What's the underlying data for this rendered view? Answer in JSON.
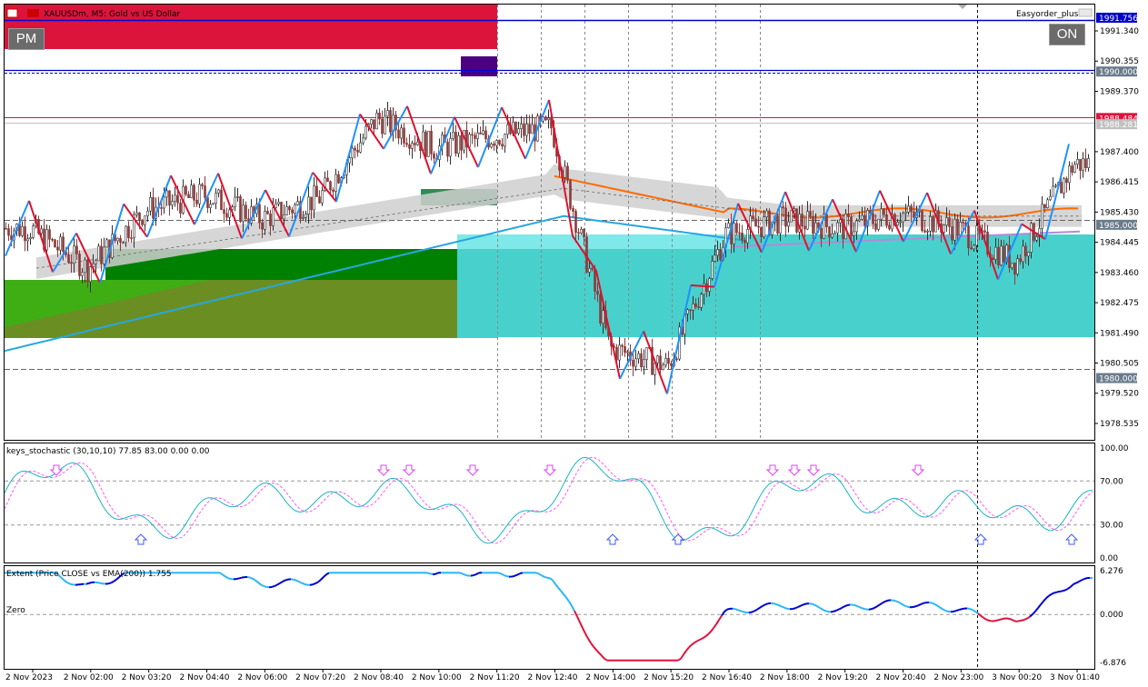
{
  "header": {
    "symbol_title": "XAUUSDm, M5:  Gold vs US Dollar",
    "ea_name": "Easyorder_plus"
  },
  "buttons": {
    "pm": "PM",
    "on": "ON"
  },
  "colors": {
    "bull_candle": "#2f2f2f",
    "bear_candle": "#8b3a3a",
    "zigzag_up": "#1e90ff",
    "zigzag_down": "#e0102c",
    "ema": "#27a7e0",
    "orange_line": "#ff6a00",
    "zone_red": "#dc143c",
    "zone_cyan": "#48d1cc",
    "zone_green": "#008000",
    "zone_olive": "#6b8e23",
    "zone_lime": "#3cb310",
    "stoch_main": "#1ab3c4",
    "stoch_signal": "#ff55ff",
    "extent_up": "#0000cd",
    "extent_up2": "#29b6f6",
    "extent_down": "#e0103c"
  },
  "price_axis": {
    "labels": [
      "1991.340",
      "1990.355",
      "1989.370",
      "1987.400",
      "1986.415",
      "1985.430",
      "1984.445",
      "1983.460",
      "1982.475",
      "1981.490",
      "1980.505",
      "1979.520",
      "1978.535"
    ],
    "tags": [
      {
        "text": "1991.756",
        "bg": "#0000cd",
        "fg": "#ffffff"
      },
      {
        "text": "1990.000",
        "bg": "#6a7b8c",
        "fg": "#ffffff"
      },
      {
        "text": "1988.484",
        "bg": "#dc143c",
        "fg": "#ffffff"
      },
      {
        "text": "1988.281",
        "bg": "#c0c0c0",
        "fg": "#ffffff"
      },
      {
        "text": "1985.000",
        "bg": "#6a7b8c",
        "fg": "#ffffff"
      },
      {
        "text": "1980.000",
        "bg": "#6a7b8c",
        "fg": "#ffffff"
      }
    ]
  },
  "stochastic": {
    "title": "keys_stochastic (30,10,10) 77.85 83.00 0.00 0.00",
    "levels": [
      "100.00",
      "70.00",
      "30.00",
      "0.00"
    ]
  },
  "extent": {
    "title": "Extent (Price CLOSE vs EMA(200)) 1.755",
    "zero_label": "Zero",
    "levels": [
      "6.276",
      "0.000",
      "-6.876"
    ]
  },
  "time_axis": {
    "labels": [
      "2 Nov 2023",
      "2 Nov 02:00",
      "2 Nov 03:20",
      "2 Nov 04:40",
      "2 Nov 06:00",
      "2 Nov 07:20",
      "2 Nov 08:40",
      "2 Nov 10:00",
      "2 Nov 11:20",
      "2 Nov 12:40",
      "2 Nov 14:00",
      "2 Nov 15:20",
      "2 Nov 16:40",
      "2 Nov 18:00",
      "2 Nov 19:20",
      "2 Nov 20:40",
      "2 Nov 23:00",
      "3 Nov 00:20",
      "3 Nov 01:40"
    ]
  },
  "chart_data": {
    "type": "candlestick",
    "symbol": "XAUUSDm",
    "timeframe": "M5",
    "ylim": [
      1978.0,
      1992.2
    ],
    "close_path": [
      [
        "2 Nov 2023",
        1984.9
      ],
      [
        "2 Nov 02:00",
        1983.6
      ],
      [
        "2 Nov 03:20",
        1985.5
      ],
      [
        "2 Nov 04:40",
        1986.0
      ],
      [
        "2 Nov 06:00",
        1985.2
      ],
      [
        "2 Nov 07:20",
        1985.9
      ],
      [
        "2 Nov 08:40",
        1988.5
      ],
      [
        "2 Nov 10:00",
        1987.5
      ],
      [
        "2 Nov 11:20",
        1987.9
      ],
      [
        "2 Nov 12:40",
        1988.2
      ],
      [
        "2 Nov 14:00",
        1981.0
      ],
      [
        "2 Nov 15:20",
        1980.4
      ],
      [
        "2 Nov 16:40",
        1984.7
      ],
      [
        "2 Nov 18:00",
        1985.2
      ],
      [
        "2 Nov 19:20",
        1984.9
      ],
      [
        "2 Nov 20:40",
        1985.4
      ],
      [
        "2 Nov 23:00",
        1984.9
      ],
      [
        "3 Nov 00:20",
        1983.8
      ],
      [
        "3 Nov 01:40",
        1987.0
      ]
    ],
    "horizontal_levels": [
      1991.756,
      1990.0,
      1988.484,
      1988.281,
      1985.0,
      1980.0
    ],
    "stochastic_levels": [
      100,
      70,
      30,
      0
    ],
    "extent_range": [
      -6.876,
      6.276
    ]
  }
}
